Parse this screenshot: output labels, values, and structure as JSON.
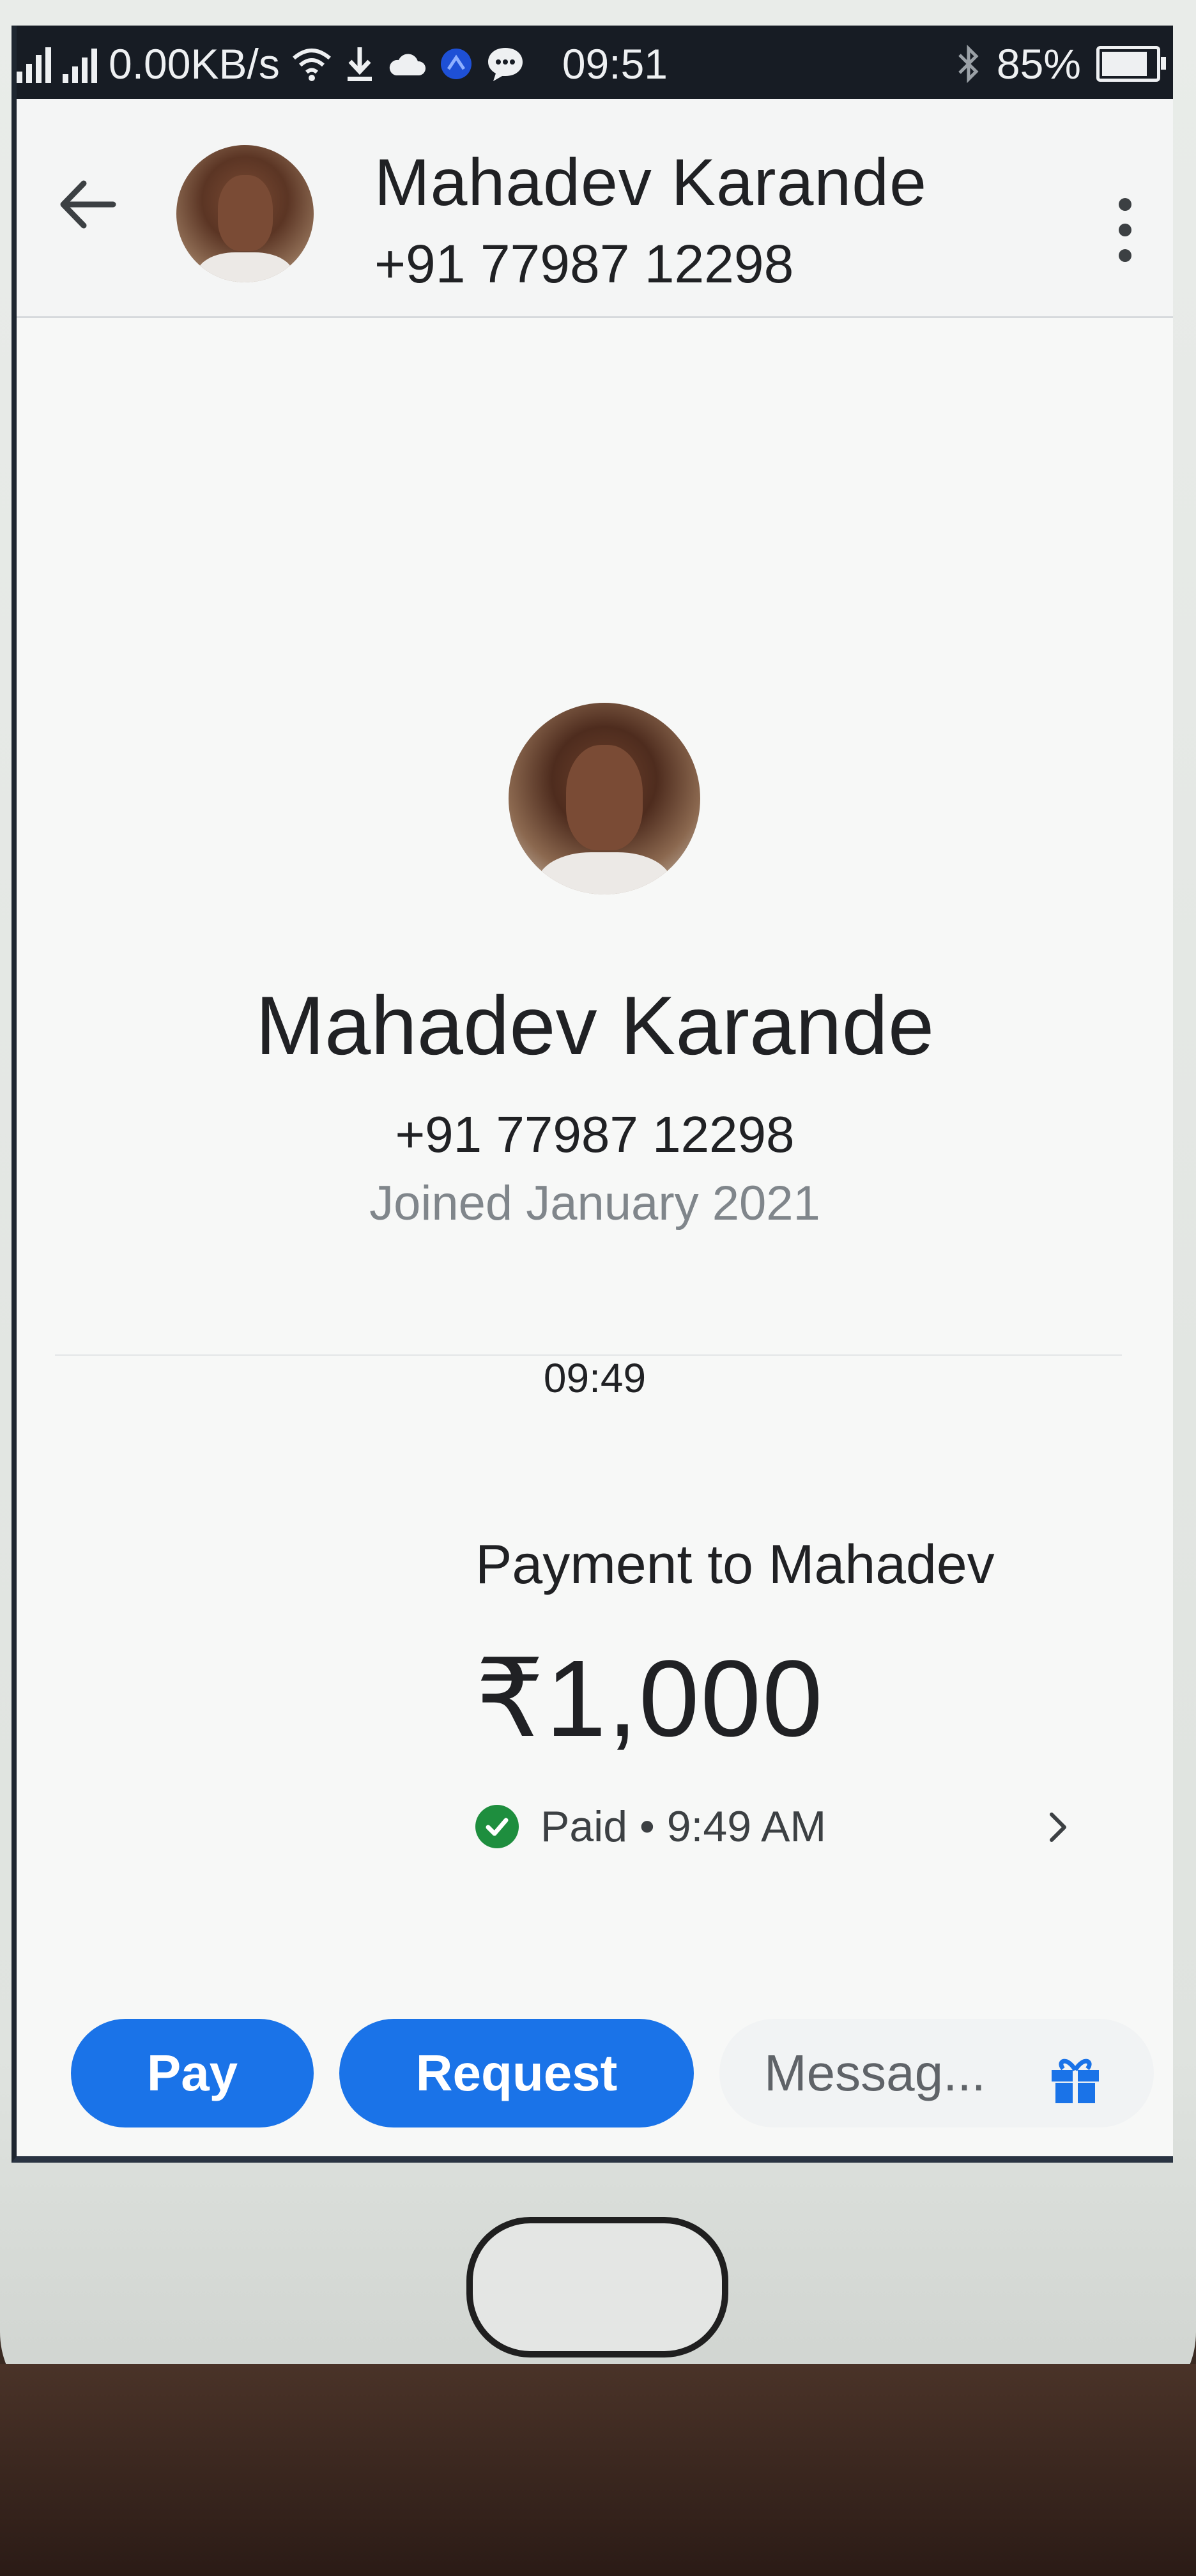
{
  "status_bar": {
    "network_speed": "0.00KB/s",
    "time": "09:51",
    "battery_percent": "85%",
    "battery_level": 0.85,
    "icons": [
      "signal-icon",
      "wifi-icon",
      "download-icon",
      "cloud-icon",
      "app-icon",
      "chat-icon",
      "bluetooth-icon",
      "battery-icon"
    ]
  },
  "header": {
    "contact_name": "Mahadev Karande",
    "contact_phone": "+91 77987 12298"
  },
  "profile": {
    "name": "Mahadev Karande",
    "phone": "+91 77987 12298",
    "joined": "Joined January 2021"
  },
  "conversation": {
    "time_label": "09:49"
  },
  "payment": {
    "title": "Payment to Mahadev",
    "amount": "₹1,000",
    "status": "Paid • 9:49 AM",
    "status_color": "#1e8e3e"
  },
  "bottom_bar": {
    "pay_label": "Pay",
    "request_label": "Request",
    "message_placeholder": "Messag...",
    "accent": "#1a73e8"
  }
}
